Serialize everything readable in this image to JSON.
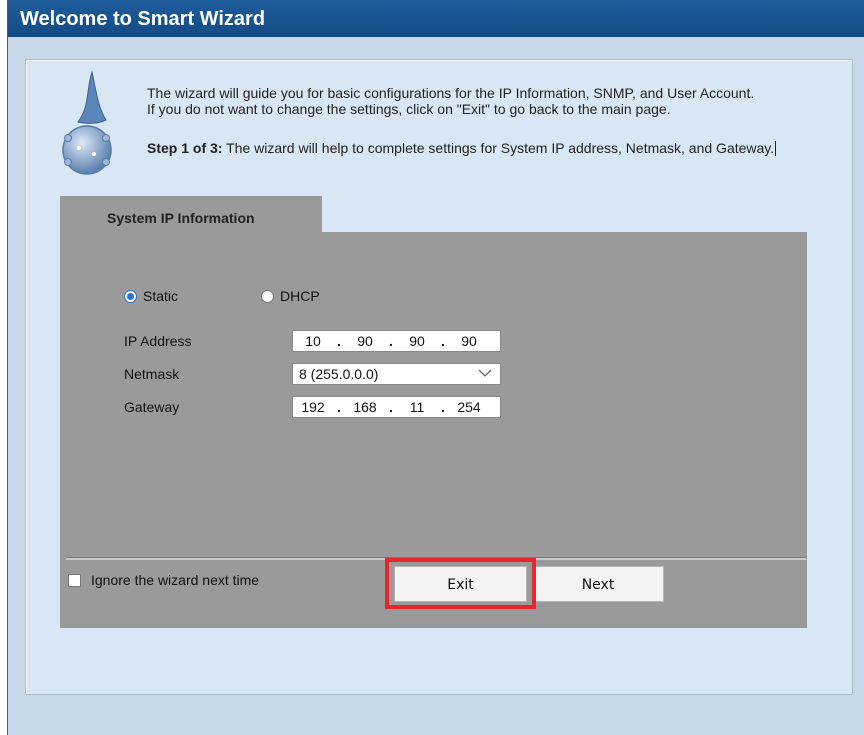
{
  "window": {
    "title": "Welcome to Smart Wizard"
  },
  "intro": {
    "line1": "The wizard will guide you for basic configurations for the IP Information, SNMP, and User Account.",
    "line2": "If you do not want to change the settings, click on \"Exit\" to go back to the main page."
  },
  "step": {
    "label": "Step 1 of 3:",
    "text": " The wizard will help to complete settings for System IP address, Netmask, and Gateway."
  },
  "tab": {
    "label": "System IP Information"
  },
  "mode": {
    "static_label": "Static",
    "dhcp_label": "DHCP",
    "selected": "Static"
  },
  "fields": {
    "ip_label": "IP Address",
    "ip": [
      "10",
      "90",
      "90",
      "90"
    ],
    "netmask_label": "Netmask",
    "netmask_value": "8 (255.0.0.0)",
    "gateway_label": "Gateway",
    "gateway": [
      "192",
      "168",
      "11",
      "254"
    ],
    "separator": "."
  },
  "footer": {
    "ignore_label": "Ignore the wizard next time",
    "ignore_checked": false,
    "exit_label": "Exit",
    "next_label": "Next"
  },
  "icons": {
    "wizard": "wizard-hat-icon",
    "dropdown": "chevron-down-icon"
  },
  "colors": {
    "titlebar": "#1a5592",
    "background": "#c9d9ea",
    "panel": "#9a9a9a",
    "highlight": "#e8242c",
    "radio": "#2f6fd0"
  }
}
